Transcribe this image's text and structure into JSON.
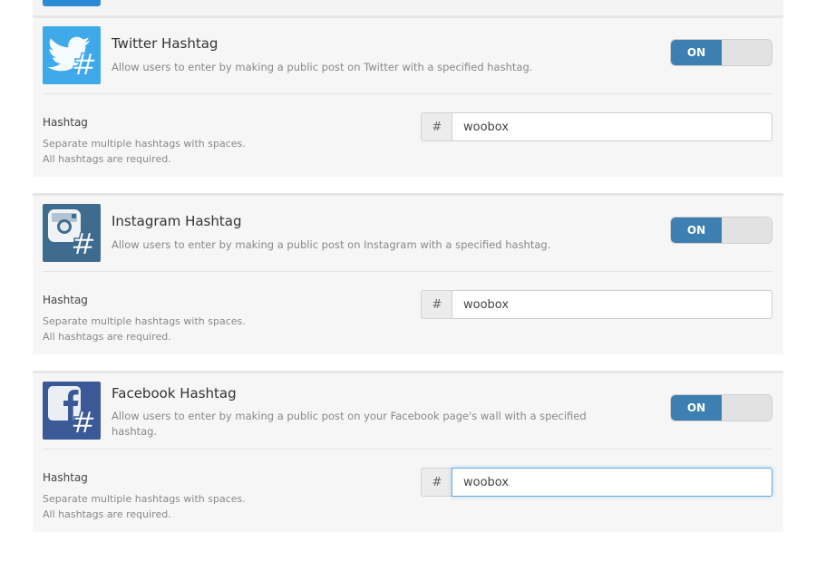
{
  "cards": [
    {
      "id": "twitter",
      "icon": "twitter-hashtag-icon",
      "title": "Twitter Hashtag",
      "description": "Allow users to enter by making a public post on Twitter with a specified hashtag.",
      "toggle_label": "ON",
      "field_label": "Hashtag",
      "help_line1": "Separate multiple hashtags with spaces.",
      "help_line2": "All hashtags are required.",
      "addon": "#",
      "value": "woobox",
      "focused": false
    },
    {
      "id": "instagram",
      "icon": "instagram-hashtag-icon",
      "title": "Instagram Hashtag",
      "description": "Allow users to enter by making a public post on Instagram with a specified hashtag.",
      "toggle_label": "ON",
      "field_label": "Hashtag",
      "help_line1": "Separate multiple hashtags with spaces.",
      "help_line2": "All hashtags are required.",
      "addon": "#",
      "value": "woobox",
      "focused": false
    },
    {
      "id": "facebook",
      "icon": "facebook-hashtag-icon",
      "title": "Facebook Hashtag",
      "description": "Allow users to enter by making a public post on your Facebook page's wall with a specified hashtag.",
      "toggle_label": "ON",
      "field_label": "Hashtag",
      "help_line1": "Separate multiple hashtags with spaces.",
      "help_line2": "All hashtags are required.",
      "addon": "#",
      "value": "woobox",
      "focused": true
    }
  ],
  "colors": {
    "twitter": "#3fa9ea",
    "instagram": "#3f6c8e",
    "facebook": "#3b5997",
    "toggle_on": "#3c7fb0"
  }
}
